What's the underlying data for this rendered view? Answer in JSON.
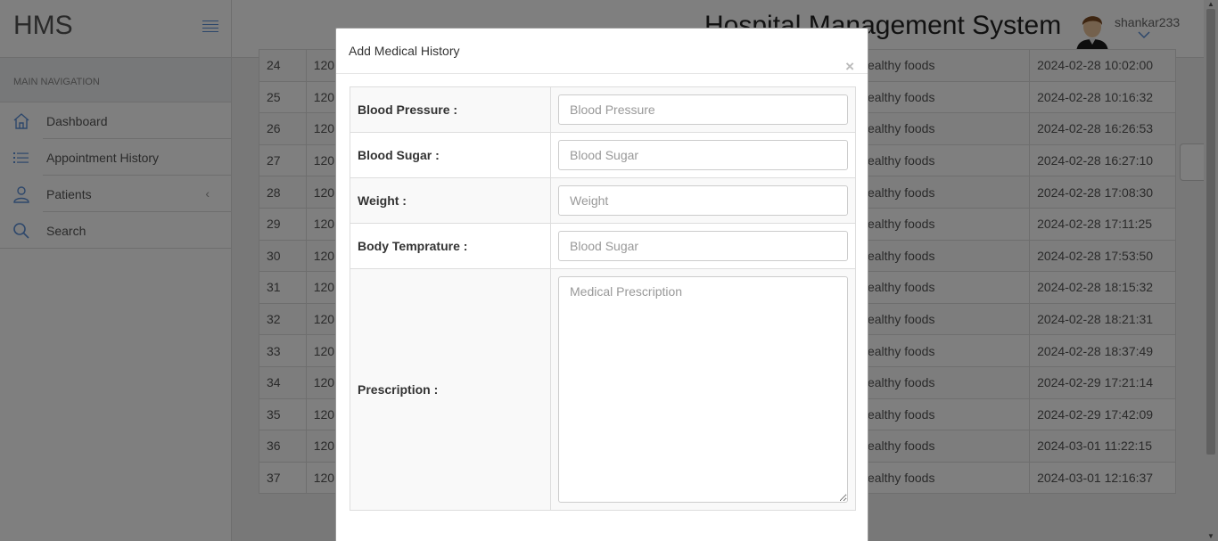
{
  "sidebar": {
    "brand": "HMS",
    "nav_heading": "MAIN NAVIGATION",
    "items": [
      {
        "label": "Dashboard",
        "icon": "home-icon"
      },
      {
        "label": "Appointment History",
        "icon": "list-icon"
      },
      {
        "label": "Patients",
        "icon": "user-icon"
      },
      {
        "label": "Search",
        "icon": "search-icon"
      }
    ]
  },
  "header": {
    "title": "Hospital Management System",
    "username": "shankar233"
  },
  "table": {
    "rows": [
      {
        "id": "24",
        "bp": "120",
        "advice": "ealthy foods",
        "date": "2024-02-28 10:02:00"
      },
      {
        "id": "25",
        "bp": "120",
        "advice": "ealthy foods",
        "date": "2024-02-28 10:16:32"
      },
      {
        "id": "26",
        "bp": "120",
        "advice": "ealthy foods",
        "date": "2024-02-28 16:26:53"
      },
      {
        "id": "27",
        "bp": "120",
        "advice": "ealthy foods",
        "date": "2024-02-28 16:27:10"
      },
      {
        "id": "28",
        "bp": "120",
        "advice": "ealthy foods",
        "date": "2024-02-28 17:08:30"
      },
      {
        "id": "29",
        "bp": "120",
        "advice": "ealthy foods",
        "date": "2024-02-28 17:11:25"
      },
      {
        "id": "30",
        "bp": "120",
        "advice": "ealthy foods",
        "date": "2024-02-28 17:53:50"
      },
      {
        "id": "31",
        "bp": "120",
        "advice": "ealthy foods",
        "date": "2024-02-28 18:15:32"
      },
      {
        "id": "32",
        "bp": "120",
        "advice": "ealthy foods",
        "date": "2024-02-28 18:21:31"
      },
      {
        "id": "33",
        "bp": "120",
        "advice": "ealthy foods",
        "date": "2024-02-28 18:37:49"
      },
      {
        "id": "34",
        "bp": "120",
        "advice": "ealthy foods",
        "date": "2024-02-29 17:21:14"
      },
      {
        "id": "35",
        "bp": "120",
        "advice": "ealthy foods",
        "date": "2024-02-29 17:42:09"
      },
      {
        "id": "36",
        "bp": "120",
        "advice": "ealthy foods",
        "date": "2024-03-01 11:22:15"
      },
      {
        "id": "37",
        "bp": "120",
        "advice": "ealthy foods",
        "date": "2024-03-01 12:16:37"
      }
    ]
  },
  "modal": {
    "title": "Add Medical History",
    "close": "×",
    "fields": [
      {
        "label": "Blood Pressure :",
        "placeholder": "Blood Pressure"
      },
      {
        "label": "Blood Sugar :",
        "placeholder": "Blood Sugar"
      },
      {
        "label": "Weight :",
        "placeholder": "Weight"
      },
      {
        "label": "Body Temprature :",
        "placeholder": "Blood Sugar"
      }
    ],
    "prescription": {
      "label": "Prescription :",
      "placeholder": "Medical Prescription"
    }
  },
  "colors": {
    "accent": "#5b8fd6",
    "overlay": "rgba(0,0,0,0.5)"
  }
}
